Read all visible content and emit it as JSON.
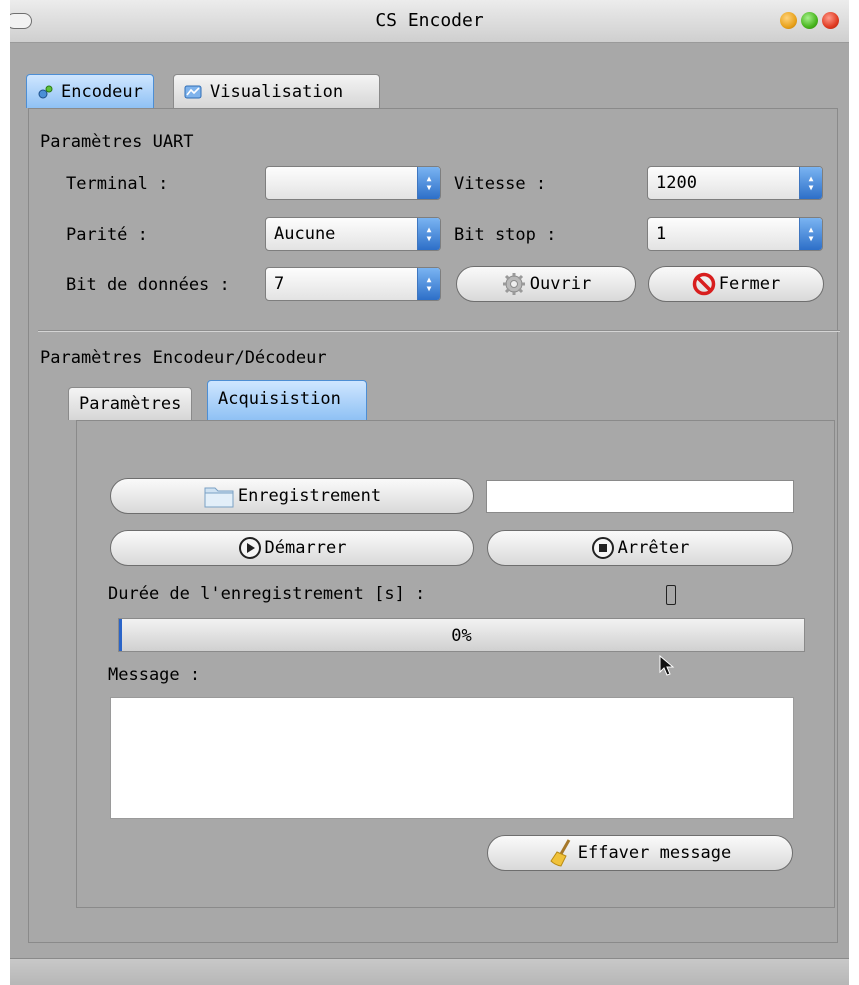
{
  "window": {
    "title": "CS Encoder"
  },
  "tabs": [
    {
      "label": "Encodeur",
      "icon": "encoder-icon",
      "active": true
    },
    {
      "label": "Visualisation",
      "icon": "chart-icon",
      "active": false
    }
  ],
  "uart": {
    "title": "Paramètres UART",
    "terminal": {
      "label": "Terminal :",
      "value": ""
    },
    "vitesse": {
      "label": "Vitesse :",
      "value": "1200"
    },
    "parite": {
      "label": "Parité :",
      "value": "Aucune"
    },
    "bit_stop": {
      "label": "Bit stop :",
      "value": "1"
    },
    "bit_donnees": {
      "label": "Bit de données :",
      "value": "7"
    },
    "ouvrir_label": "Ouvrir",
    "fermer_label": "Fermer"
  },
  "codec": {
    "title": "Paramètres Encodeur/Décodeur",
    "tabs": [
      {
        "label": "Paramètres",
        "active": false
      },
      {
        "label": "Acquisistion",
        "active": true
      }
    ]
  },
  "acquisition": {
    "enregistrement_label": "Enregistrement",
    "filename_value": "",
    "demarrer_label": "Démarrer",
    "arreter_label": "Arrêter",
    "duree_label": "Durée de l'enregistrement [s] :",
    "duree_value": "0",
    "progress": {
      "percent": 0,
      "text": "0%"
    },
    "message_label": "Message :",
    "message_value": "",
    "effacer_label": "Effaver message"
  },
  "colors": {
    "accent": "#4d8ed4",
    "window_bg": "#a8a8a8",
    "progress_fill": "#2a64c8",
    "stop_red": "#d81e1e"
  }
}
